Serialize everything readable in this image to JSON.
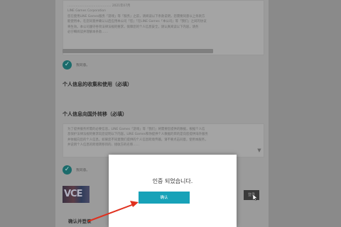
{
  "privacy_box_1": {
    "lines": [
      "…………………………………… 2021年07月",
      "LINE Games Corporation",
      "您在使用LINE Games服务「游戏」等「服务」之前，请阅读以下条款说明，您需要同意以上条款方",
      "能使用本，在您同意并确认以后应用本公司「您」「在LINE Games「本公司」等「我们」之间的协议",
      "将生效。本公司遵守各项法律法规的要求，保障您的个人信息安全，请认真阅读以下内容，请务",
      "必仔细阅读并理解本条款……"
    ]
  },
  "agree_label_1": "我同意。",
  "section_collect_title": "个人信息的收集和使用（必填）",
  "section_transfer_title": "个人信息向国外转移（必填）",
  "privacy_box_2": {
    "lines": [
      "为了提供服务所需的必要信息，LINE Games「游戏」等「我们」将需要您提供的数据，根据个人信",
      "息保护法律法规的要求向您说明以下内容。LINE Games和你提供个人数据的目的是向您提供海外服务",
      "并依据向您的个人信息，如果您不同意我们提供的个人信息跨境传输，请不要点击同意，使用本服务，",
      "并说明个人信息的跨境转移目的、接收方的名称……"
    ]
  },
  "agree_label_2": "我同意。",
  "thumb_text": "VCE",
  "side_button_label": "登录",
  "bottom_title": "确认并登录",
  "modal": {
    "message": "인증 되었습니다.",
    "confirm_label": "确认"
  },
  "icons": {
    "check": "check-circle-icon",
    "scroll_arrow": "scroll-down-arrow-icon",
    "cursor": "mouse-pointer-icon"
  },
  "colors": {
    "accent": "#17a2b8",
    "check": "#1b6b6b",
    "annotation_arrow": "#e0301e"
  }
}
